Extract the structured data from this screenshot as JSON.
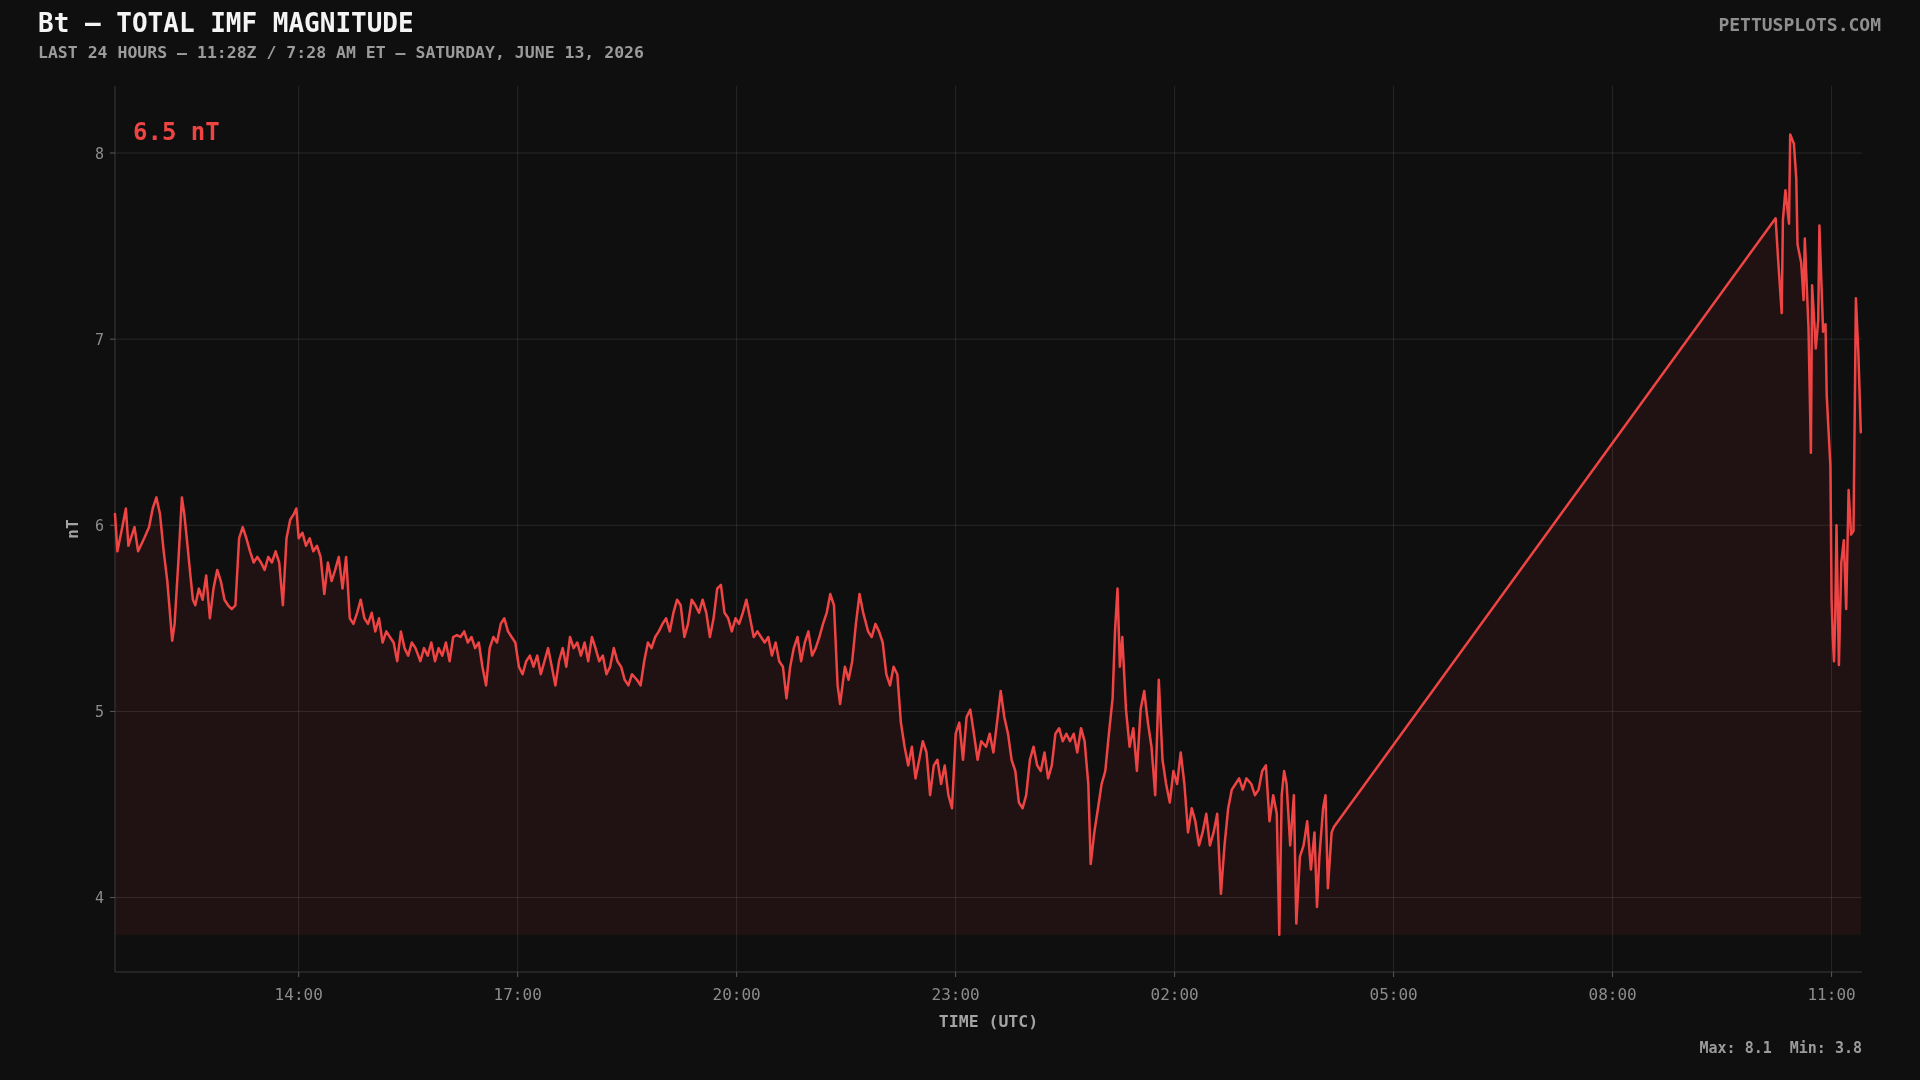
{
  "header": {
    "title": "Bt — TOTAL IMF MAGNITUDE",
    "subtitle": "LAST 24 HOURS — 11:28Z / 7:28 AM ET — SATURDAY, JUNE 13, 2026",
    "credit": "PETTUSPLOTS.COM"
  },
  "chart": {
    "current_reading": "6.5 nT",
    "chart_data": {
      "type": "area",
      "xlabel": "TIME (UTC)",
      "ylabel": "nT",
      "grid": true,
      "x": [
        "2026-06-12T11:29Z",
        "2026-06-12T11:31Z",
        "2026-06-12T11:35Z",
        "2026-06-12T11:38Z",
        "2026-06-12T11:40Z",
        "2026-06-12T11:45Z",
        "2026-06-12T11:48Z",
        "2026-06-12T11:53Z",
        "2026-06-12T11:57Z",
        "2026-06-12T12:00Z",
        "2026-06-12T12:03Z",
        "2026-06-12T12:06Z",
        "2026-06-12T12:09Z",
        "2026-06-12T12:12Z",
        "2026-06-12T12:16Z",
        "2026-06-12T12:18Z",
        "2026-06-12T12:21Z",
        "2026-06-12T12:24Z",
        "2026-06-12T12:26Z",
        "2026-06-12T12:28Z",
        "2026-06-12T12:31Z",
        "2026-06-12T12:33Z",
        "2026-06-12T12:35Z",
        "2026-06-12T12:38Z",
        "2026-06-12T12:41Z",
        "2026-06-12T12:44Z",
        "2026-06-12T12:47Z",
        "2026-06-12T12:50Z",
        "2026-06-12T12:53Z",
        "2026-06-12T12:56Z",
        "2026-06-12T12:59Z",
        "2026-06-12T13:02Z",
        "2026-06-12T13:05Z",
        "2026-06-12T13:08Z",
        "2026-06-12T13:11Z",
        "2026-06-12T13:14Z",
        "2026-06-12T13:17Z",
        "2026-06-12T13:20Z",
        "2026-06-12T13:23Z",
        "2026-06-12T13:26Z",
        "2026-06-12T13:29Z",
        "2026-06-12T13:32Z",
        "2026-06-12T13:35Z",
        "2026-06-12T13:38Z",
        "2026-06-12T13:41Z",
        "2026-06-12T13:44Z",
        "2026-06-12T13:47Z",
        "2026-06-12T13:50Z",
        "2026-06-12T13:53Z",
        "2026-06-12T13:56Z",
        "2026-06-12T13:58Z",
        "2026-06-12T14:00Z",
        "2026-06-12T14:03Z",
        "2026-06-12T14:06Z",
        "2026-06-12T14:09Z",
        "2026-06-12T14:12Z",
        "2026-06-12T14:15Z",
        "2026-06-12T14:18Z",
        "2026-06-12T14:21Z",
        "2026-06-12T14:24Z",
        "2026-06-12T14:27Z",
        "2026-06-12T14:30Z",
        "2026-06-12T14:33Z",
        "2026-06-12T14:36Z",
        "2026-06-12T14:39Z",
        "2026-06-12T14:42Z",
        "2026-06-12T14:45Z",
        "2026-06-12T14:48Z",
        "2026-06-12T14:51Z",
        "2026-06-12T14:54Z",
        "2026-06-12T14:57Z",
        "2026-06-12T15:00Z",
        "2026-06-12T15:03Z",
        "2026-06-12T15:06Z",
        "2026-06-12T15:09Z",
        "2026-06-12T15:12Z",
        "2026-06-12T15:15Z",
        "2026-06-12T15:18Z",
        "2026-06-12T15:21Z",
        "2026-06-12T15:24Z",
        "2026-06-12T15:27Z",
        "2026-06-12T15:30Z",
        "2026-06-12T15:33Z",
        "2026-06-12T15:36Z",
        "2026-06-12T15:40Z",
        "2026-06-12T15:43Z",
        "2026-06-12T15:46Z",
        "2026-06-12T15:49Z",
        "2026-06-12T15:52Z",
        "2026-06-12T15:55Z",
        "2026-06-12T15:58Z",
        "2026-06-12T16:01Z",
        "2026-06-12T16:04Z",
        "2026-06-12T16:07Z",
        "2026-06-12T16:10Z",
        "2026-06-12T16:13Z",
        "2026-06-12T16:16Z",
        "2026-06-12T16:19Z",
        "2026-06-12T16:22Z",
        "2026-06-12T16:25Z",
        "2026-06-12T16:28Z",
        "2026-06-12T16:31Z",
        "2026-06-12T16:34Z",
        "2026-06-12T16:37Z",
        "2026-06-12T16:40Z",
        "2026-06-12T16:43Z",
        "2026-06-12T16:46Z",
        "2026-06-12T16:49Z",
        "2026-06-12T16:52Z",
        "2026-06-12T16:55Z",
        "2026-06-12T16:58Z",
        "2026-06-12T17:01Z",
        "2026-06-12T17:04Z",
        "2026-06-12T17:07Z",
        "2026-06-12T17:10Z",
        "2026-06-12T17:13Z",
        "2026-06-12T17:16Z",
        "2026-06-12T17:19Z",
        "2026-06-12T17:22Z",
        "2026-06-12T17:25Z",
        "2026-06-12T17:28Z",
        "2026-06-12T17:31Z",
        "2026-06-12T17:34Z",
        "2026-06-12T17:37Z",
        "2026-06-12T17:40Z",
        "2026-06-12T17:43Z",
        "2026-06-12T17:46Z",
        "2026-06-12T17:49Z",
        "2026-06-12T17:52Z",
        "2026-06-12T17:55Z",
        "2026-06-12T17:58Z",
        "2026-06-12T18:01Z",
        "2026-06-12T18:04Z",
        "2026-06-12T18:07Z",
        "2026-06-12T18:10Z",
        "2026-06-12T18:13Z",
        "2026-06-12T18:16Z",
        "2026-06-12T18:19Z",
        "2026-06-12T18:22Z",
        "2026-06-12T18:25Z",
        "2026-06-12T18:28Z",
        "2026-06-12T18:31Z",
        "2026-06-12T18:34Z",
        "2026-06-12T18:38Z",
        "2026-06-12T18:41Z",
        "2026-06-12T18:44Z",
        "2026-06-12T18:47Z",
        "2026-06-12T18:50Z",
        "2026-06-12T18:53Z",
        "2026-06-12T18:56Z",
        "2026-06-12T18:59Z",
        "2026-06-12T19:02Z",
        "2026-06-12T19:05Z",
        "2026-06-12T19:08Z",
        "2026-06-12T19:11Z",
        "2026-06-12T19:14Z",
        "2026-06-12T19:17Z",
        "2026-06-12T19:20Z",
        "2026-06-12T19:23Z",
        "2026-06-12T19:26Z",
        "2026-06-12T19:29Z",
        "2026-06-12T19:32Z",
        "2026-06-12T19:35Z",
        "2026-06-12T19:38Z",
        "2026-06-12T19:41Z",
        "2026-06-12T19:44Z",
        "2026-06-12T19:47Z",
        "2026-06-12T19:50Z",
        "2026-06-12T19:53Z",
        "2026-06-12T19:56Z",
        "2026-06-12T19:59Z",
        "2026-06-12T20:02Z",
        "2026-06-12T20:05Z",
        "2026-06-12T20:08Z",
        "2026-06-12T20:11Z",
        "2026-06-12T20:14Z",
        "2026-06-12T20:17Z",
        "2026-06-12T20:20Z",
        "2026-06-12T20:23Z",
        "2026-06-12T20:26Z",
        "2026-06-12T20:29Z",
        "2026-06-12T20:32Z",
        "2026-06-12T20:35Z",
        "2026-06-12T20:38Z",
        "2026-06-12T20:41Z",
        "2026-06-12T20:44Z",
        "2026-06-12T20:47Z",
        "2026-06-12T20:50Z",
        "2026-06-12T20:53Z",
        "2026-06-12T20:56Z",
        "2026-06-12T20:59Z",
        "2026-06-12T21:02Z",
        "2026-06-12T21:05Z",
        "2026-06-12T21:08Z",
        "2026-06-12T21:11Z",
        "2026-06-12T21:14Z",
        "2026-06-12T21:17Z",
        "2026-06-12T21:20Z",
        "2026-06-12T21:23Z",
        "2026-06-12T21:25Z",
        "2026-06-12T21:29Z",
        "2026-06-12T21:32Z",
        "2026-06-12T21:35Z",
        "2026-06-12T21:38Z",
        "2026-06-12T21:41Z",
        "2026-06-12T21:44Z",
        "2026-06-12T21:48Z",
        "2026-06-12T21:51Z",
        "2026-06-12T21:54Z",
        "2026-06-12T21:57Z",
        "2026-06-12T22:00Z",
        "2026-06-12T22:03Z",
        "2026-06-12T22:06Z",
        "2026-06-12T22:09Z",
        "2026-06-12T22:12Z",
        "2026-06-12T22:15Z",
        "2026-06-12T22:18Z",
        "2026-06-12T22:21Z",
        "2026-06-12T22:24Z",
        "2026-06-12T22:27Z",
        "2026-06-12T22:30Z",
        "2026-06-12T22:33Z",
        "2026-06-12T22:36Z",
        "2026-06-12T22:39Z",
        "2026-06-12T22:42Z",
        "2026-06-12T22:45Z",
        "2026-06-12T22:48Z",
        "2026-06-12T22:51Z",
        "2026-06-12T22:54Z",
        "2026-06-12T22:57Z",
        "2026-06-12T23:00Z",
        "2026-06-12T23:03Z",
        "2026-06-12T23:06Z",
        "2026-06-12T23:09Z",
        "2026-06-12T23:12Z",
        "2026-06-12T23:15Z",
        "2026-06-12T23:18Z",
        "2026-06-12T23:21Z",
        "2026-06-12T23:25Z",
        "2026-06-12T23:28Z",
        "2026-06-12T23:31Z",
        "2026-06-12T23:34Z",
        "2026-06-12T23:37Z",
        "2026-06-12T23:40Z",
        "2026-06-12T23:43Z",
        "2026-06-12T23:46Z",
        "2026-06-12T23:49Z",
        "2026-06-12T23:52Z",
        "2026-06-12T23:55Z",
        "2026-06-12T23:58Z",
        "2026-06-13T00:01Z",
        "2026-06-13T00:04Z",
        "2026-06-13T00:07Z",
        "2026-06-13T00:10Z",
        "2026-06-13T00:13Z",
        "2026-06-13T00:16Z",
        "2026-06-13T00:19Z",
        "2026-06-13T00:22Z",
        "2026-06-13T00:25Z",
        "2026-06-13T00:28Z",
        "2026-06-13T00:31Z",
        "2026-06-13T00:34Z",
        "2026-06-13T00:37Z",
        "2026-06-13T00:40Z",
        "2026-06-13T00:43Z",
        "2026-06-13T00:46Z",
        "2026-06-13T00:49Z",
        "2026-06-13T00:51Z",
        "2026-06-13T00:54Z",
        "2026-06-13T00:57Z",
        "2026-06-13T01:00Z",
        "2026-06-13T01:03Z",
        "2026-06-13T01:06Z",
        "2026-06-13T01:09Z",
        "2026-06-13T01:11Z",
        "2026-06-13T01:13Z",
        "2026-06-13T01:15Z",
        "2026-06-13T01:17Z",
        "2026-06-13T01:20Z",
        "2026-06-13T01:23Z",
        "2026-06-13T01:26Z",
        "2026-06-13T01:29Z",
        "2026-06-13T01:32Z",
        "2026-06-13T01:35Z",
        "2026-06-13T01:38Z",
        "2026-06-13T01:41Z",
        "2026-06-13T01:44Z",
        "2026-06-13T01:47Z",
        "2026-06-13T01:50Z",
        "2026-06-13T01:53Z",
        "2026-06-13T01:56Z",
        "2026-06-13T01:59Z",
        "2026-06-13T02:02Z",
        "2026-06-13T02:05Z",
        "2026-06-13T02:08Z",
        "2026-06-13T02:11Z",
        "2026-06-13T02:14Z",
        "2026-06-13T02:17Z",
        "2026-06-13T02:20Z",
        "2026-06-13T02:23Z",
        "2026-06-13T02:26Z",
        "2026-06-13T02:29Z",
        "2026-06-13T02:32Z",
        "2026-06-13T02:35Z",
        "2026-06-13T02:38Z",
        "2026-06-13T02:41Z",
        "2026-06-13T02:44Z",
        "2026-06-13T02:47Z",
        "2026-06-13T02:50Z",
        "2026-06-13T02:53Z",
        "2026-06-13T02:56Z",
        "2026-06-13T02:59Z",
        "2026-06-13T03:03Z",
        "2026-06-13T03:06Z",
        "2026-06-13T03:09Z",
        "2026-06-13T03:12Z",
        "2026-06-13T03:15Z",
        "2026-06-13T03:18Z",
        "2026-06-13T03:21Z",
        "2026-06-13T03:24Z",
        "2026-06-13T03:26Z",
        "2026-06-13T03:28Z",
        "2026-06-13T03:30Z",
        "2026-06-13T03:32Z",
        "2026-06-13T03:35Z",
        "2026-06-13T03:38Z",
        "2026-06-13T03:40Z",
        "2026-06-13T03:43Z",
        "2026-06-13T03:46Z",
        "2026-06-13T03:49Z",
        "2026-06-13T03:52Z",
        "2026-06-13T03:55Z",
        "2026-06-13T03:57Z",
        "2026-06-13T03:59Z",
        "2026-06-13T04:02Z",
        "2026-06-13T04:04Z",
        "2026-06-13T04:06Z",
        "2026-06-13T04:09Z",
        "2026-06-13T04:11Z",
        "2026-06-13T10:14Z",
        "2026-06-13T10:16Z",
        "2026-06-13T10:19Z",
        "2026-06-13T10:20Z",
        "2026-06-13T10:22Z",
        "2026-06-13T10:25Z",
        "2026-06-13T10:26Z",
        "2026-06-13T10:29Z",
        "2026-06-13T10:31Z",
        "2026-06-13T10:32Z",
        "2026-06-13T10:35Z",
        "2026-06-13T10:37Z",
        "2026-06-13T10:38Z",
        "2026-06-13T10:41Z",
        "2026-06-13T10:43Z",
        "2026-06-13T10:44Z",
        "2026-06-13T10:47Z",
        "2026-06-13T10:49Z",
        "2026-06-13T10:50Z",
        "2026-06-13T10:53Z",
        "2026-06-13T10:55Z",
        "2026-06-13T10:56Z",
        "2026-06-13T10:59Z",
        "2026-06-13T11:00Z",
        "2026-06-13T11:01Z",
        "2026-06-13T11:02Z",
        "2026-06-13T11:03Z",
        "2026-06-13T11:04Z",
        "2026-06-13T11:06Z",
        "2026-06-13T11:08Z",
        "2026-06-13T11:10Z",
        "2026-06-13T11:12Z",
        "2026-06-13T11:14Z",
        "2026-06-13T11:16Z",
        "2026-06-13T11:18Z",
        "2026-06-13T11:20Z",
        "2026-06-13T11:22Z",
        "2026-06-13T11:24Z"
      ],
      "series": [
        {
          "color": "#ef4444",
          "values": [
            6.06,
            5.86,
            5.99,
            6.09,
            5.89,
            5.99,
            5.86,
            5.93,
            5.99,
            6.09,
            6.15,
            6.06,
            5.86,
            5.7,
            5.38,
            5.47,
            5.8,
            6.15,
            6.06,
            5.93,
            5.73,
            5.6,
            5.57,
            5.66,
            5.6,
            5.73,
            5.5,
            5.66,
            5.76,
            5.7,
            5.6,
            5.57,
            5.55,
            5.57,
            5.93,
            5.99,
            5.93,
            5.86,
            5.8,
            5.83,
            5.8,
            5.76,
            5.83,
            5.8,
            5.86,
            5.8,
            5.57,
            5.93,
            6.03,
            6.06,
            6.09,
            5.93,
            5.96,
            5.89,
            5.93,
            5.86,
            5.89,
            5.83,
            5.63,
            5.8,
            5.7,
            5.76,
            5.83,
            5.66,
            5.83,
            5.5,
            5.47,
            5.53,
            5.6,
            5.5,
            5.47,
            5.53,
            5.43,
            5.5,
            5.37,
            5.43,
            5.4,
            5.37,
            5.27,
            5.43,
            5.34,
            5.3,
            5.37,
            5.34,
            5.27,
            5.34,
            5.3,
            5.37,
            5.27,
            5.34,
            5.3,
            5.37,
            5.27,
            5.4,
            5.41,
            5.4,
            5.43,
            5.37,
            5.4,
            5.34,
            5.37,
            5.24,
            5.14,
            5.34,
            5.4,
            5.37,
            5.47,
            5.5,
            5.43,
            5.4,
            5.37,
            5.24,
            5.2,
            5.27,
            5.3,
            5.24,
            5.3,
            5.2,
            5.27,
            5.34,
            5.24,
            5.14,
            5.27,
            5.34,
            5.24,
            5.4,
            5.34,
            5.37,
            5.3,
            5.37,
            5.27,
            5.4,
            5.34,
            5.27,
            5.3,
            5.2,
            5.24,
            5.34,
            5.27,
            5.24,
            5.17,
            5.14,
            5.2,
            5.17,
            5.14,
            5.27,
            5.37,
            5.34,
            5.4,
            5.43,
            5.47,
            5.5,
            5.43,
            5.53,
            5.6,
            5.57,
            5.4,
            5.47,
            5.6,
            5.57,
            5.53,
            5.6,
            5.53,
            5.4,
            5.5,
            5.66,
            5.68,
            5.53,
            5.5,
            5.43,
            5.5,
            5.47,
            5.53,
            5.6,
            5.5,
            5.4,
            5.43,
            5.4,
            5.37,
            5.4,
            5.3,
            5.37,
            5.27,
            5.24,
            5.07,
            5.24,
            5.34,
            5.4,
            5.27,
            5.37,
            5.43,
            5.3,
            5.34,
            5.4,
            5.47,
            5.53,
            5.63,
            5.57,
            5.14,
            5.04,
            5.24,
            5.17,
            5.27,
            5.47,
            5.63,
            5.53,
            5.43,
            5.4,
            5.47,
            5.43,
            5.37,
            5.2,
            5.14,
            5.24,
            5.2,
            4.94,
            4.81,
            4.71,
            4.81,
            4.64,
            4.74,
            4.84,
            4.78,
            4.55,
            4.71,
            4.74,
            4.61,
            4.71,
            4.55,
            4.48,
            4.88,
            4.94,
            4.74,
            4.97,
            5.01,
            4.88,
            4.74,
            4.84,
            4.81,
            4.88,
            4.78,
            4.94,
            5.11,
            4.97,
            4.88,
            4.74,
            4.68,
            4.51,
            4.48,
            4.55,
            4.74,
            4.81,
            4.71,
            4.68,
            4.78,
            4.64,
            4.71,
            4.88,
            4.91,
            4.84,
            4.88,
            4.84,
            4.88,
            4.78,
            4.91,
            4.84,
            4.61,
            4.18,
            4.35,
            4.48,
            4.61,
            4.68,
            4.88,
            5.07,
            5.43,
            5.66,
            5.24,
            5.4,
            5.01,
            4.81,
            4.91,
            4.68,
            5.01,
            5.11,
            4.94,
            4.81,
            4.55,
            5.17,
            4.74,
            4.61,
            4.51,
            4.68,
            4.61,
            4.78,
            4.61,
            4.35,
            4.48,
            4.41,
            4.28,
            4.35,
            4.45,
            4.28,
            4.35,
            4.45,
            4.02,
            4.28,
            4.48,
            4.58,
            4.61,
            4.64,
            4.58,
            4.64,
            4.61,
            4.55,
            4.58,
            4.68,
            4.71,
            4.41,
            4.55,
            4.45,
            3.8,
            4.55,
            4.68,
            4.61,
            4.28,
            4.55,
            3.86,
            4.22,
            4.28,
            4.41,
            4.15,
            4.35,
            3.95,
            4.22,
            4.48,
            4.55,
            4.05,
            4.35,
            4.38,
            7.65,
            7.43,
            7.14,
            7.64,
            7.8,
            7.62,
            8.1,
            8.05,
            7.86,
            7.51,
            7.41,
            7.21,
            7.54,
            7.06,
            6.39,
            7.29,
            6.95,
            7.1,
            7.61,
            7.04,
            7.08,
            6.7,
            6.32,
            5.6,
            5.4,
            5.27,
            5.5,
            6.0,
            5.25,
            5.8,
            5.92,
            5.55,
            6.19,
            5.95,
            5.97,
            7.22,
            6.92,
            6.5
          ]
        }
      ],
      "xlim": [
        "2026-06-12T11:29Z",
        "2026-06-13T11:25Z"
      ],
      "ylim": [
        3.6,
        8.36
      ],
      "xticks": [
        {
          "value": "2026-06-12T14:00Z",
          "label": "14:00"
        },
        {
          "value": "2026-06-12T17:00Z",
          "label": "17:00"
        },
        {
          "value": "2026-06-12T20:00Z",
          "label": "20:00"
        },
        {
          "value": "2026-06-12T23:00Z",
          "label": "23:00"
        },
        {
          "value": "2026-06-13T02:00Z",
          "label": "02:00"
        },
        {
          "value": "2026-06-13T05:00Z",
          "label": "05:00"
        },
        {
          "value": "2026-06-13T08:00Z",
          "label": "08:00"
        },
        {
          "value": "2026-06-13T11:00Z",
          "label": "11:00"
        }
      ],
      "yticks": [
        4,
        5,
        6,
        7,
        8
      ]
    }
  },
  "stats": [
    "Max: 8.1",
    "Min: 3.8"
  ]
}
